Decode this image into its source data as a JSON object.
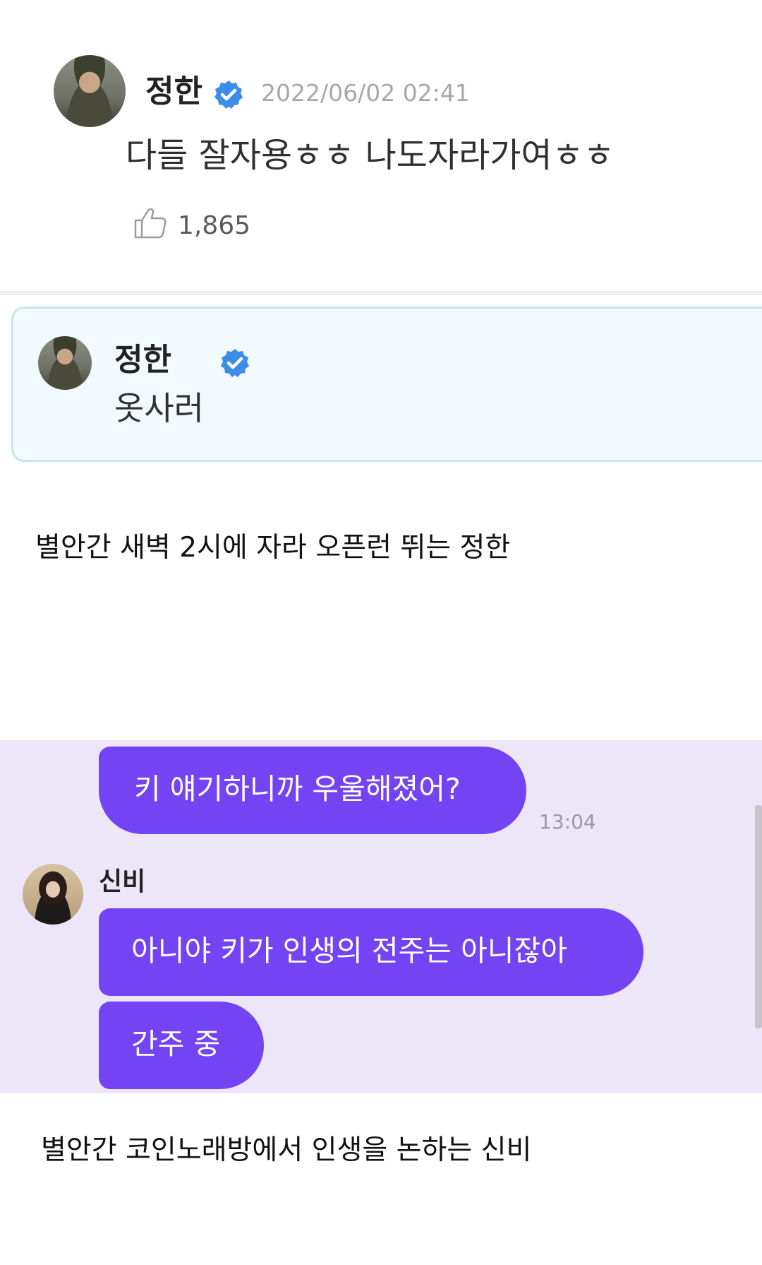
{
  "post": {
    "author": "정한",
    "timestamp": "2022/06/02 02:41",
    "text": "다들 잘자용ㅎㅎ 나도자라가여ㅎㅎ",
    "likes": "1,865"
  },
  "reply": {
    "author": "정한",
    "text": "옷사러"
  },
  "caption1": "별안간 새벽 2시에 자라 오픈런 뛰는 정한",
  "chat": {
    "sent_message": "키 얘기하니까 우울해졌어?",
    "sent_time": "13:04",
    "sender_name": "신비",
    "messages": [
      "아니야 키가 인생의 전주는 아니잖아",
      "간주 중"
    ]
  },
  "caption2": "별안간 코인노래방에서 인생을 논하는 신비",
  "colors": {
    "verified": "#3b8de8",
    "bubble": "#7343f4",
    "chat_background": "#ece6f8",
    "reply_border": "#c8e4ee"
  },
  "icons": [
    "verified-badge-icon",
    "thumbs-up-icon"
  ]
}
